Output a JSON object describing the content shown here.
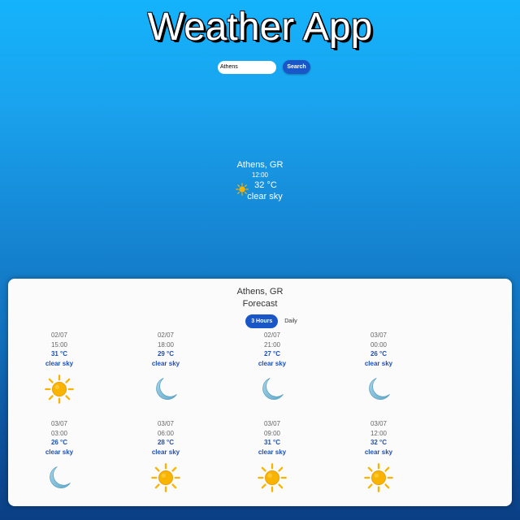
{
  "app": {
    "title": "Weather App"
  },
  "search": {
    "value": "Athens",
    "button_label": "Search"
  },
  "current": {
    "city": "Athens, GR",
    "time": "12:00",
    "temperature": "32 °C",
    "description": "clear sky",
    "icon": "sun-icon"
  },
  "forecast": {
    "city": "Athens, GR",
    "subtitle": "Forecast",
    "tabs": [
      {
        "label": "3 Hours",
        "active": true
      },
      {
        "label": "Daily",
        "active": false
      }
    ],
    "items": [
      {
        "date": "02/07",
        "time": "15:00",
        "temp": "31 °C",
        "desc": "clear sky",
        "icon": "sun-icon"
      },
      {
        "date": "02/07",
        "time": "18:00",
        "temp": "29 °C",
        "desc": "clear sky",
        "icon": "moon-icon"
      },
      {
        "date": "02/07",
        "time": "21:00",
        "temp": "27 °C",
        "desc": "clear sky",
        "icon": "moon-icon"
      },
      {
        "date": "03/07",
        "time": "00:00",
        "temp": "26 °C",
        "desc": "clear sky",
        "icon": "moon-icon"
      },
      {
        "date": "03/07",
        "time": "03:00",
        "temp": "26 °C",
        "desc": "clear sky",
        "icon": "moon-icon"
      },
      {
        "date": "03/07",
        "time": "06:00",
        "temp": "28 °C",
        "desc": "clear sky",
        "icon": "sun-icon"
      },
      {
        "date": "03/07",
        "time": "09:00",
        "temp": "31 °C",
        "desc": "clear sky",
        "icon": "sun-icon"
      },
      {
        "date": "03/07",
        "time": "12:00",
        "temp": "32 °C",
        "desc": "clear sky",
        "icon": "sun-icon"
      }
    ]
  },
  "colors": {
    "accent": "#1957c8",
    "forecast_text": "#1d4fb8",
    "sun": "#f8b400",
    "moon": "#7bbbd6"
  }
}
